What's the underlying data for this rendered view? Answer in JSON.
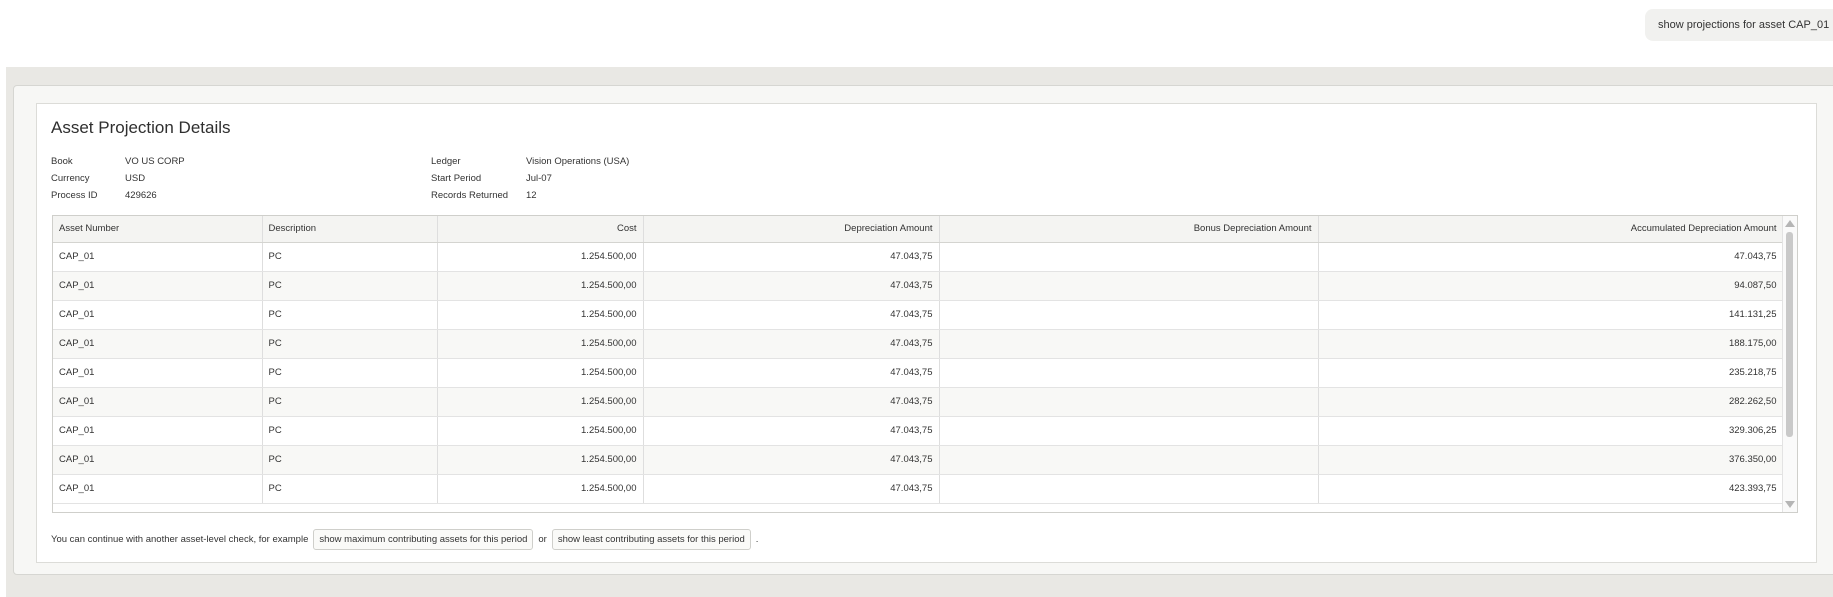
{
  "user_message": "show projections for asset CAP_01",
  "card": {
    "title": "Asset Projection Details",
    "meta_left": [
      {
        "label": "Book",
        "value": "VO US CORP"
      },
      {
        "label": "Currency",
        "value": "USD"
      },
      {
        "label": "Process ID",
        "value": "429626"
      }
    ],
    "meta_right": [
      {
        "label": "Ledger",
        "value": "Vision Operations (USA)"
      },
      {
        "label": "Start Period",
        "value": "Jul-07"
      },
      {
        "label": "Records Returned",
        "value": "12"
      }
    ]
  },
  "table": {
    "columns": [
      "Asset Number",
      "Description",
      "Cost",
      "Depreciation Amount",
      "Bonus Depreciation Amount",
      "Accumulated Depreciation Amount"
    ],
    "rows": [
      [
        "CAP_01",
        "PC",
        "1.254.500,00",
        "47.043,75",
        "",
        "47.043,75"
      ],
      [
        "CAP_01",
        "PC",
        "1.254.500,00",
        "47.043,75",
        "",
        "94.087,50"
      ],
      [
        "CAP_01",
        "PC",
        "1.254.500,00",
        "47.043,75",
        "",
        "141.131,25"
      ],
      [
        "CAP_01",
        "PC",
        "1.254.500,00",
        "47.043,75",
        "",
        "188.175,00"
      ],
      [
        "CAP_01",
        "PC",
        "1.254.500,00",
        "47.043,75",
        "",
        "235.218,75"
      ],
      [
        "CAP_01",
        "PC",
        "1.254.500,00",
        "47.043,75",
        "",
        "282.262,50"
      ],
      [
        "CAP_01",
        "PC",
        "1.254.500,00",
        "47.043,75",
        "",
        "329.306,25"
      ],
      [
        "CAP_01",
        "PC",
        "1.254.500,00",
        "47.043,75",
        "",
        "376.350,00"
      ],
      [
        "CAP_01",
        "PC",
        "1.254.500,00",
        "47.043,75",
        "",
        "423.393,75"
      ]
    ]
  },
  "footer": {
    "prefix": "You can continue with another asset-level check, for example",
    "chip1": "show maximum contributing assets for this period",
    "or_text": "or",
    "chip2": "show least contributing assets for this period",
    "suffix": "."
  }
}
